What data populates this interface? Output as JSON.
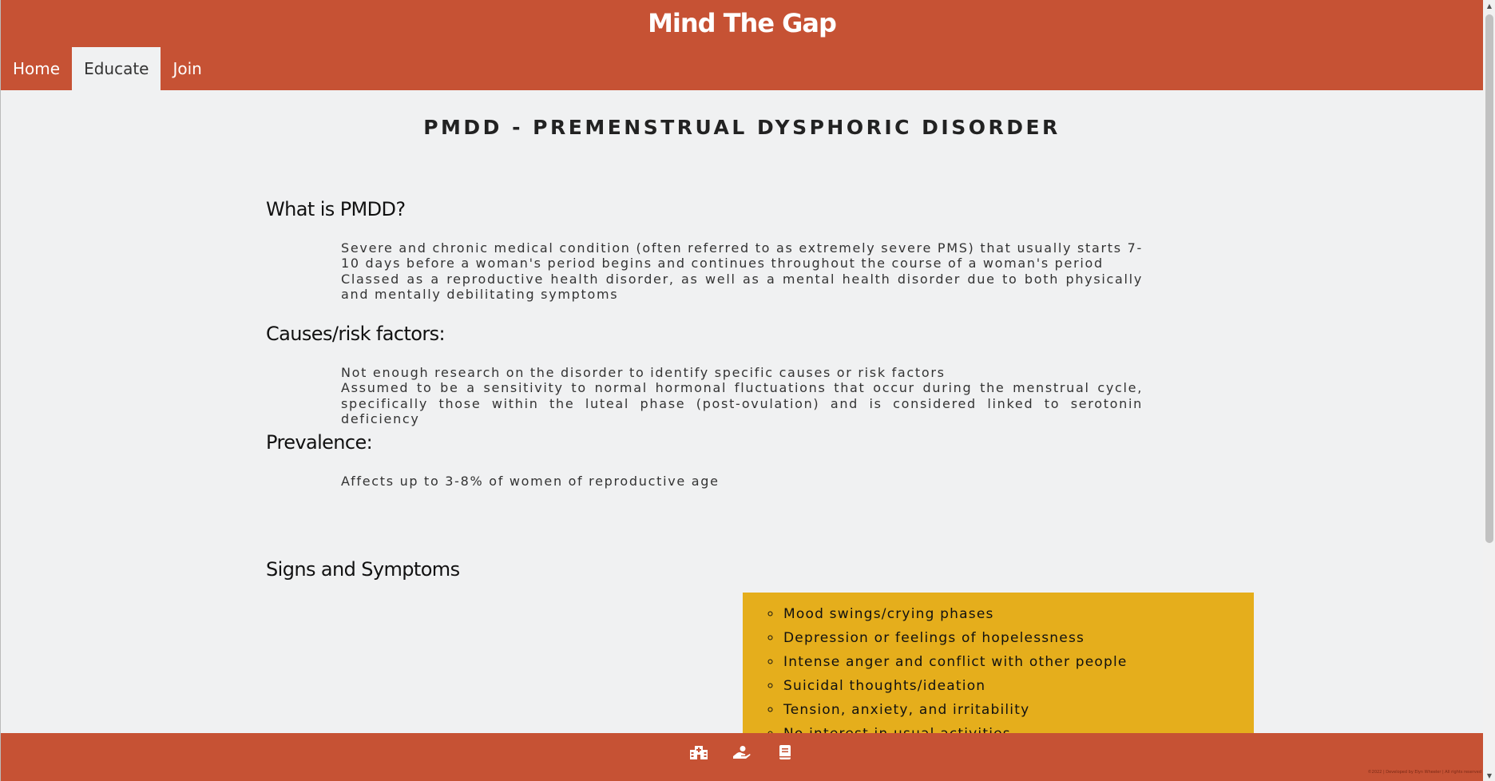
{
  "header": {
    "site_title": "Mind The Gap",
    "nav": [
      {
        "label": "Home",
        "active": false
      },
      {
        "label": "Educate",
        "active": true
      },
      {
        "label": "Join",
        "active": false
      }
    ]
  },
  "page": {
    "title": "PMDD - PREMENSTRUAL DYSPHORIC DISORDER",
    "sections": [
      {
        "heading": "What is PMDD?",
        "paragraphs": [
          "Severe and chronic medical condition (often referred to as extremely severe PMS) that usually starts 7-10 days before a woman's period begins and continues throughout the course of a woman's period",
          "Classed as a reproductive health disorder, as well as a mental health disorder due to both physically and mentally debilitating symptoms"
        ]
      },
      {
        "heading": "Causes/risk factors:",
        "paragraphs": [
          "Not enough research on the disorder to identify specific causes or risk factors",
          "Assumed to be a sensitivity to normal hormonal fluctuations that occur during the menstrual cycle, specifically those within the luteal phase (post-ovulation) and is considered linked to serotonin deficiency"
        ]
      },
      {
        "heading": "Prevalence:",
        "paragraphs": [
          "Affects up to 3-8% of women of reproductive age"
        ]
      }
    ],
    "symptoms": {
      "heading": "Signs and Symptoms",
      "items": [
        "Mood swings/crying phases",
        "Depression or feelings of hopelessness",
        "Intense anger and conflict with other people",
        "Suicidal thoughts/ideation",
        "Tension, anxiety, and irritability",
        "No interest in usual activities"
      ]
    }
  },
  "footer": {
    "icons": [
      "hospital-icon",
      "donate-hand-icon",
      "book-icon"
    ],
    "copyright": "©2022 | Developed by Elyn Wheeler | All rights reserved"
  },
  "colors": {
    "brand": "#c65234",
    "background": "#f0f1f2",
    "symptom_box": "#e5ae1c"
  }
}
